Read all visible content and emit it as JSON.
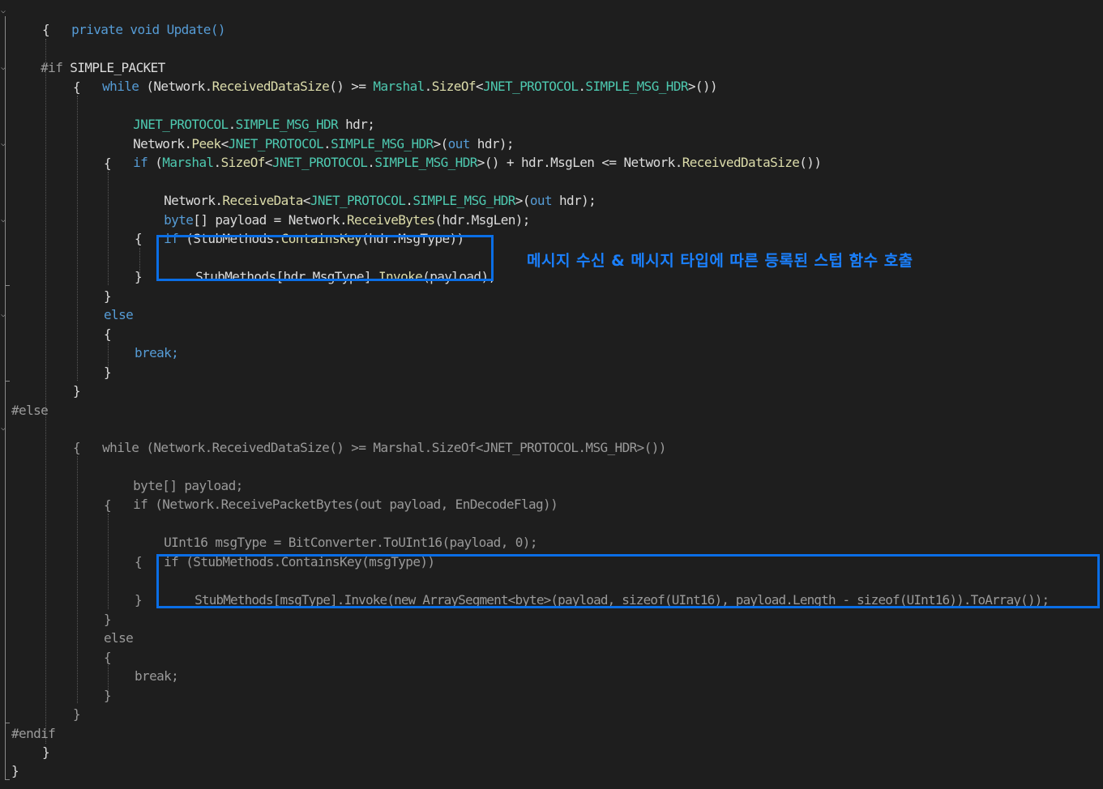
{
  "code": {
    "l1": [
      "private",
      " ",
      "void",
      " ",
      "Update",
      "()"
    ],
    "l2": "{",
    "l3": [
      "#if",
      " SIMPLE_PACKET"
    ],
    "l4": [
      "while",
      " (",
      "Network",
      ".",
      "ReceivedDataSize",
      "() >= ",
      "Marshal",
      ".",
      "SizeOf",
      "<",
      "JNET_PROTOCOL",
      ".",
      "SIMPLE_MSG_HDR",
      ">())"
    ],
    "l5": "{",
    "l6": [
      "JNET_PROTOCOL",
      ".",
      "SIMPLE_MSG_HDR",
      " hdr;"
    ],
    "l7": [
      "Network",
      ".",
      "Peek",
      "<",
      "JNET_PROTOCOL",
      ".",
      "SIMPLE_MSG_HDR",
      ">(",
      "out",
      " hdr);"
    ],
    "l8": [
      "if",
      " (",
      "Marshal",
      ".",
      "SizeOf",
      "<",
      "JNET_PROTOCOL",
      ".",
      "SIMPLE_MSG_HDR",
      ">() + hdr.MsgLen <= ",
      "Network",
      ".",
      "ReceivedDataSize",
      "())"
    ],
    "l9": "{",
    "l10": [
      "Network",
      ".",
      "ReceiveData",
      "<",
      "JNET_PROTOCOL",
      ".",
      "SIMPLE_MSG_HDR",
      ">(",
      "out",
      " hdr);"
    ],
    "l11": [
      "byte",
      "[] payload = ",
      "Network",
      ".",
      "ReceiveBytes",
      "(hdr.MsgLen);"
    ],
    "l12": [
      "if",
      " (",
      "StubMethods",
      ".",
      "ContainsKey",
      "(hdr.MsgType))"
    ],
    "l13": "{",
    "l14": [
      "StubMethods",
      "[hdr.MsgType].",
      "Invoke",
      "(payload);"
    ],
    "l15": "}",
    "l16": "}",
    "l17": "else",
    "l18": "{",
    "l19": "break;",
    "l20": "}",
    "l21": "}",
    "l22": "#else",
    "l23": [
      "while",
      " (",
      "Network",
      ".",
      "ReceivedDataSize",
      "() >= ",
      "Marshal",
      ".",
      "SizeOf",
      "<",
      "JNET_PROTOCOL",
      ".",
      "MSG_HDR",
      ">())"
    ],
    "l24": "{",
    "l25": [
      "byte",
      "[] payload;"
    ],
    "l26": [
      "if",
      " (",
      "Network",
      ".",
      "ReceivePacketBytes",
      "(",
      "out",
      " payload, EnDecodeFlag))"
    ],
    "l27": "{",
    "l28": [
      "UInt16",
      " msgType = ",
      "BitConverter",
      ".",
      "ToUInt16",
      "(payload, 0);"
    ],
    "l29": [
      "if",
      " (",
      "StubMethods",
      ".",
      "ContainsKey",
      "(msgType))"
    ],
    "l30": "{",
    "l31": [
      "StubMethods",
      "[msgType].",
      "Invoke",
      "(",
      "new",
      " ",
      "ArraySegment",
      "<",
      "byte",
      ">(payload, ",
      "sizeof",
      "(",
      "UInt16",
      "), payload.Length - ",
      "sizeof",
      "(",
      "UInt16",
      ")).",
      "ToArray",
      "());"
    ],
    "l32": "}",
    "l33": "}",
    "l34": "else",
    "l35": "{",
    "l36": "break;",
    "l37": "}",
    "l38": "}",
    "l39": "#endif",
    "l40": "}",
    "l41": "}"
  },
  "annotation": {
    "text": "메시지 수신 & 메시지 타입에 따른 등록된 스텁 함수 호출"
  },
  "colors": {
    "background": "#1e1e1e",
    "keyword": "#569cd6",
    "type": "#4ec9b0",
    "method": "#dcdcaa",
    "highlight_box": "#0a6ee6",
    "annotation": "#1a80ff"
  },
  "icons": {
    "fold": "chevron-down-icon"
  }
}
